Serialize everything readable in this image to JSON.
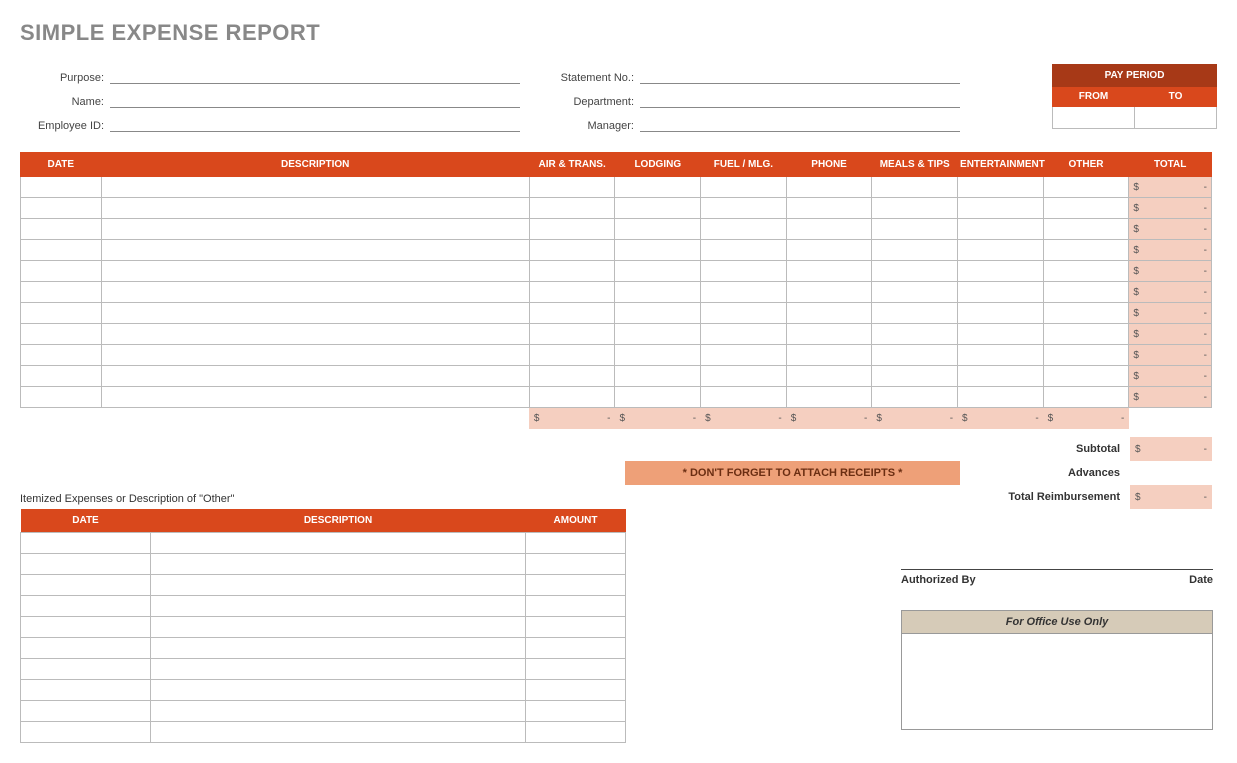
{
  "title": "SIMPLE EXPENSE REPORT",
  "fields": {
    "purpose": "Purpose:",
    "name": "Name:",
    "employee_id": "Employee ID:",
    "statement_no": "Statement No.:",
    "department": "Department:",
    "manager": "Manager:"
  },
  "pay_period": {
    "title": "PAY PERIOD",
    "from": "FROM",
    "to": "TO"
  },
  "main_cols": {
    "date": "DATE",
    "desc": "DESCRIPTION",
    "air": "AIR & TRANS.",
    "lodging": "LODGING",
    "fuel": "FUEL / MLG.",
    "phone": "PHONE",
    "meals": "MEALS & TIPS",
    "ent": "ENTERTAINMENT",
    "other": "OTHER",
    "total": "TOTAL"
  },
  "row_count": 11,
  "money": {
    "sym": "$",
    "dash": "-"
  },
  "summary": {
    "subtotal": "Subtotal",
    "advances": "Advances",
    "total_reimb": "Total Reimbursement"
  },
  "receipts": "* DON'T FORGET TO ATTACH RECEIPTS *",
  "itemized_title": "Itemized Expenses or Description of \"Other\"",
  "item_cols": {
    "date": "DATE",
    "desc": "DESCRIPTION",
    "amount": "AMOUNT"
  },
  "item_row_count": 10,
  "sig": {
    "auth": "Authorized By",
    "date": "Date"
  },
  "office": "For Office Use Only"
}
